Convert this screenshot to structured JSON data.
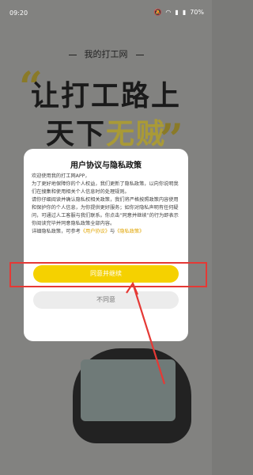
{
  "status_bar": {
    "time": "09:20",
    "battery": "70%"
  },
  "background": {
    "brand": "我的打工网",
    "headline_line1": "让打工路上",
    "headline_line2_prefix": "天下",
    "headline_line2_accent": "无贼",
    "quote_open": "“",
    "quote_close": "”"
  },
  "dialog": {
    "title": "用户协议与隐私政策",
    "body_p1": "欢迎使用我的打工网APP，",
    "body_p2": "为了更好地保障你的个人权益，我们更新了隐私政策，以向你说明我们在搜集和使用相关个人信息时的处理规则。",
    "body_p3": "请你仔细阅读并确认隐私权相关政策，我们将严格按照政策内容使用和保护你的个人信息，为你提供更好服务；如你对隐私声明有任何疑问，可通过人工客服与我们联系。你点击“同意并继续”的行为即表示你阅读完毕并同意隐私政策全部内容。",
    "body_p4_prefix": "详细隐私政策，可参考",
    "link_user_agreement": "《用户协议》",
    "and_text": "与",
    "link_privacy_policy": "《隐私政策》",
    "agree_label": "同意并继续",
    "disagree_label": "不同意"
  },
  "colors": {
    "accent": "#f5d100",
    "annotation": "#e53935"
  }
}
